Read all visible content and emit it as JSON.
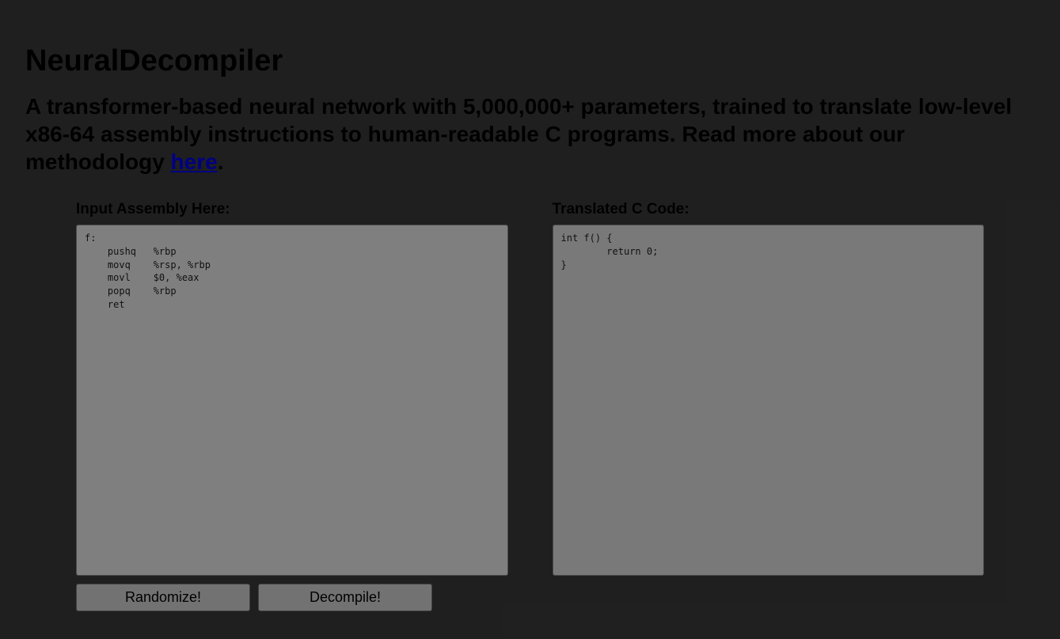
{
  "header": {
    "title": "NeuralDecompiler",
    "subtitle_pre": "A transformer-based neural network with 5,000,000+ parameters, trained to translate low-level x86-64 assembly instructions to human-readable C programs. Read more about our methodology ",
    "subtitle_link": "here",
    "subtitle_post": "."
  },
  "input_panel": {
    "label": "Input Assembly Here:",
    "content": "f:\n    pushq   %rbp\n    movq    %rsp, %rbp\n    movl    $0, %eax\n    popq    %rbp\n    ret"
  },
  "output_panel": {
    "label": "Translated C Code:",
    "content": "int f() {\n        return 0;\n}"
  },
  "buttons": {
    "randomize": "Randomize!",
    "decompile": "Decompile!"
  }
}
